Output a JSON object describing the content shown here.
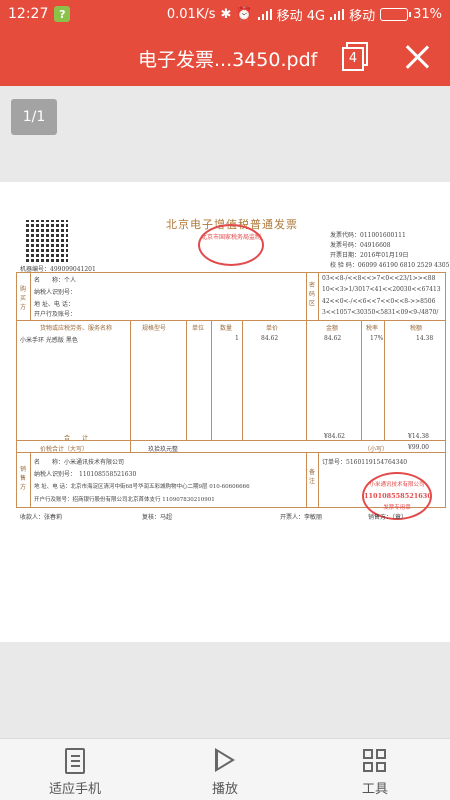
{
  "status_bar": {
    "time": "12:27",
    "app_badge": "?",
    "speed": "0.01K/s",
    "bluetooth": "✱",
    "alarm": "⏰",
    "carrier1": "移动 4G",
    "carrier2": "移动",
    "battery": "31%"
  },
  "header": {
    "title": "电子发票...3450.pdf",
    "pages_count": "4"
  },
  "page_indicator": "1/1",
  "invoice": {
    "title": "北京电子增值税普通发票",
    "machine_no": "机器编号：499099041201",
    "invoice_code": "发票代码：011001600111",
    "invoice_no": "发票号码：04916608",
    "issue_date": "开票日期：2016年01月19日",
    "check_code": "校 验 码：06099 46190 6810 2529 4305",
    "buyer_label": "购买方",
    "buyer_name": "名　　称：个人",
    "buyer_tax": "纳税人识别号：",
    "buyer_addr": "地 址、电 话：",
    "buyer_bank": "开户行及账号：",
    "cipher_label": "密码区",
    "cipher_1": "03<<8-/<<8<<>7<0<<23/1>><88",
    "cipher_2": "10<<3>1/3017<41<<20030<<67413",
    "cipher_3": "42<<0<-/<<6<<7<<0<<8->>8506",
    "cipher_4": "3<<1057<30350<5831<09<9-/4870/",
    "col_goods": "货物或应税劳务、服务名称",
    "col_spec": "规格型号",
    "col_unit": "单位",
    "col_qty": "数量",
    "col_price": "单价",
    "col_amount": "金额",
    "col_rate": "税率",
    "col_tax": "税额",
    "item_name": "小米手环 光感版 黑色",
    "item_qty": "1",
    "item_price": "84.62",
    "item_amount": "84.62",
    "item_rate": "17%",
    "item_tax": "14.38",
    "total_label": "合　　计",
    "total_amount": "¥84.62",
    "total_tax": "¥14.38",
    "grand_label": "价税合计（大写）",
    "grand_words": "玖拾玖元整",
    "grand_small_label": "（小写）",
    "grand_small": "¥99.00",
    "seller_label": "销售方",
    "seller_name": "名　　称：小米通讯技术有限公司",
    "seller_tax": "纳税人识别号：　110108558521630",
    "seller_addr": "地 址、电 话：北京市海淀区清河中街68号华润五彩城购物中心二期9层 010-60606666",
    "seller_bank": "开户行及账号：招商银行股份有限公司北京首体支行 110907830210901",
    "remark_label": "备注",
    "order_no": "订单号：5160119154764340",
    "payee": "收款人：张春莉",
    "reviewer": "复核：马超",
    "drawer": "开票人：李敏丽",
    "seller_mark": "销售方：（章）",
    "stamp_top": "北京市国家税务局监制",
    "stamp_seller_top": "小米通讯技术有限公司",
    "stamp_seller_no": "110108558521630",
    "stamp_seller_bottom": "发票专用章"
  },
  "toolbar": {
    "fit_label": "适应手机",
    "play_label": "播放",
    "tools_label": "工具"
  }
}
